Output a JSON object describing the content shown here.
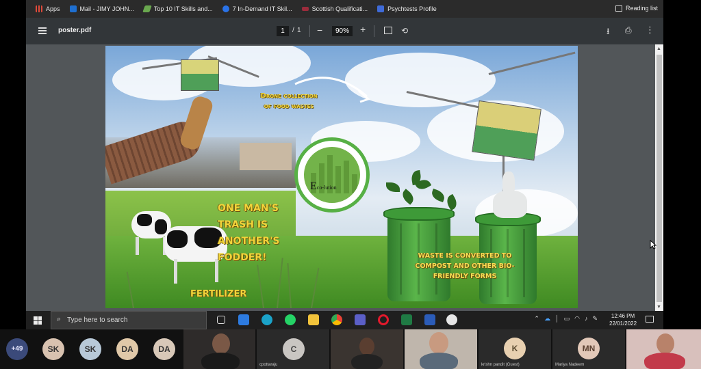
{
  "bookmarks": [
    {
      "label": "Apps",
      "icon": "apps-grid-icon",
      "color": "#e04a3a"
    },
    {
      "label": "Mail - JIMY JOHN...",
      "icon": "outlook-icon",
      "color": "#1e6fd0"
    },
    {
      "label": "Top 10 IT Skills and...",
      "icon": "bookmark-leaf-icon",
      "color": "#6aa84f"
    },
    {
      "label": "7 In-Demand IT Skil...",
      "icon": "coursera-icon",
      "color": "#2a73e8"
    },
    {
      "label": "Scottish Qualificati...",
      "icon": "sqa-icon",
      "color": "#9b2c3c"
    },
    {
      "label": "Psychtests Profile",
      "icon": "psychtests-icon",
      "color": "#3f6bd8"
    }
  ],
  "reading_list": "Reading list",
  "pdf": {
    "title": "poster.pdf",
    "page_current": "1",
    "page_sep": "/",
    "page_total": "1",
    "zoom": "90%",
    "zoom_minus": "−",
    "zoom_plus": "+"
  },
  "poster": {
    "drone_text": "Drone collection of food wastes",
    "trash_text": "One man's trash is another's fodder!",
    "fertilizer_text": "Fertilizer",
    "waste_text": "Waste is converted to compost and other bio-friendly forms",
    "logo_big": "E",
    "logo_small": "co-lution"
  },
  "taskbar": {
    "search_placeholder": "Type here to search",
    "time": "12:46 PM",
    "date": "22/01/2022",
    "apps": [
      {
        "name": "task-view-icon",
        "color": "#dddddd"
      },
      {
        "name": "photos-app-icon",
        "color": "#2d7be0"
      },
      {
        "name": "edge-icon",
        "color": "#1ba3c9"
      },
      {
        "name": "whatsapp-icon",
        "color": "#25d366"
      },
      {
        "name": "file-explorer-icon",
        "color": "#f2c33b"
      },
      {
        "name": "chrome-icon",
        "color": "#e94235"
      },
      {
        "name": "teams-icon",
        "color": "#5b5fc7"
      },
      {
        "name": "opera-icon",
        "color": "#e3192c"
      },
      {
        "name": "excel-icon",
        "color": "#1f7a44"
      },
      {
        "name": "word-icon",
        "color": "#2b5cb8"
      },
      {
        "name": "weather-widget-icon",
        "color": "#e6e6e6"
      }
    ]
  },
  "participants": {
    "overflow_count": "+49",
    "initials": [
      {
        "text": "SK",
        "bg": "#d8c2b0"
      },
      {
        "text": "SK",
        "bg": "#b8c9d8"
      },
      {
        "text": "DA",
        "bg": "#e0c8a8"
      },
      {
        "text": "DA",
        "bg": "#d8c8b8"
      }
    ],
    "tile_c": {
      "initial": "C",
      "label": "cpottaraju"
    },
    "tile_k": {
      "initial": "K",
      "label": "krishn pandit (Guest)"
    },
    "tile_mn": {
      "initial": "MN",
      "label": "Mariya Nadeem"
    }
  }
}
